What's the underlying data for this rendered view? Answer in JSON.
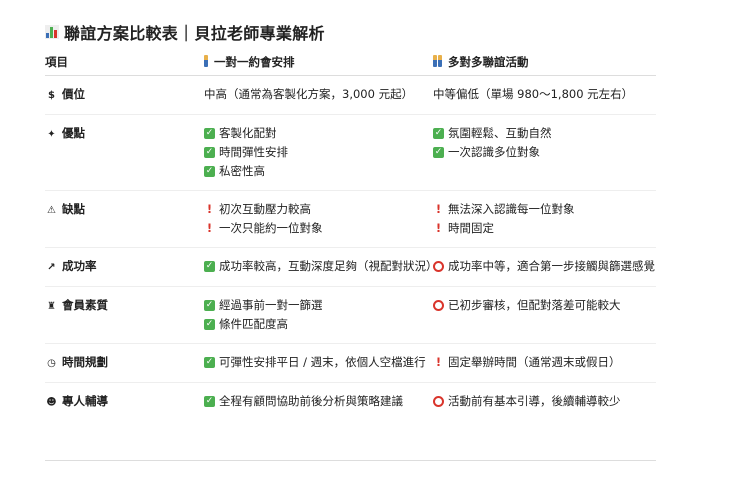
{
  "title": "聯誼方案比較表｜貝拉老師專業解析",
  "colors": {
    "check": "#4caf50",
    "warn": "#d9342b"
  },
  "headers": [
    "項目",
    "一對一約會安排",
    "多對多聯誼活動"
  ],
  "rows": [
    {
      "label": "價位",
      "icon": "money-bag-icon",
      "glyph": "$",
      "a": [
        {
          "t": "text",
          "v": "中高（通常為客製化方案，3,000 元起）"
        }
      ],
      "b": [
        {
          "t": "text",
          "v": "中等偏低（單場 980～1,800 元左右）"
        }
      ]
    },
    {
      "label": "優點",
      "icon": "star-icon",
      "glyph": "✦",
      "a": [
        {
          "t": "check",
          "v": "客製化配對"
        },
        {
          "t": "check",
          "v": "時間彈性安排"
        },
        {
          "t": "check",
          "v": "私密性高"
        }
      ],
      "b": [
        {
          "t": "check",
          "v": "氛圍輕鬆、互動自然"
        },
        {
          "t": "check",
          "v": "一次認識多位對象"
        }
      ]
    },
    {
      "label": "缺點",
      "icon": "warning-icon",
      "glyph": "⚠",
      "a": [
        {
          "t": "exc",
          "v": "初次互動壓力較高"
        },
        {
          "t": "exc",
          "v": "一次只能約一位對象"
        }
      ],
      "b": [
        {
          "t": "exc",
          "v": "無法深入認識每一位對象"
        },
        {
          "t": "exc",
          "v": "時間固定"
        }
      ]
    },
    {
      "label": "成功率",
      "icon": "chart-up-icon",
      "glyph": "↗",
      "a": [
        {
          "t": "check",
          "v": "成功率較高，互動深度足夠（視配對狀況）"
        }
      ],
      "b": [
        {
          "t": "circle",
          "v": "成功率中等，適合第一步接觸與篩選感覺"
        }
      ]
    },
    {
      "label": "會員素質",
      "icon": "graduate-icon",
      "glyph": "♜",
      "a": [
        {
          "t": "check",
          "v": "經過事前一對一篩選"
        },
        {
          "t": "check",
          "v": "條件匹配度高"
        }
      ],
      "b": [
        {
          "t": "circle",
          "v": "已初步審核，但配對落差可能較大"
        }
      ]
    },
    {
      "label": "時間規劃",
      "icon": "clock-icon",
      "glyph": "◷",
      "a": [
        {
          "t": "check",
          "v": "可彈性安排平日 / 週末，依個人空檔進行"
        }
      ],
      "b": [
        {
          "t": "exc",
          "v": "固定舉辦時間（通常週末或假日）"
        }
      ]
    },
    {
      "label": "專人輔導",
      "icon": "teacher-icon",
      "glyph": "☻",
      "a": [
        {
          "t": "check",
          "v": "全程有顧問協助前後分析與策略建議"
        }
      ],
      "b": [
        {
          "t": "circle",
          "v": "活動前有基本引導，後續輔導較少"
        }
      ]
    }
  ]
}
